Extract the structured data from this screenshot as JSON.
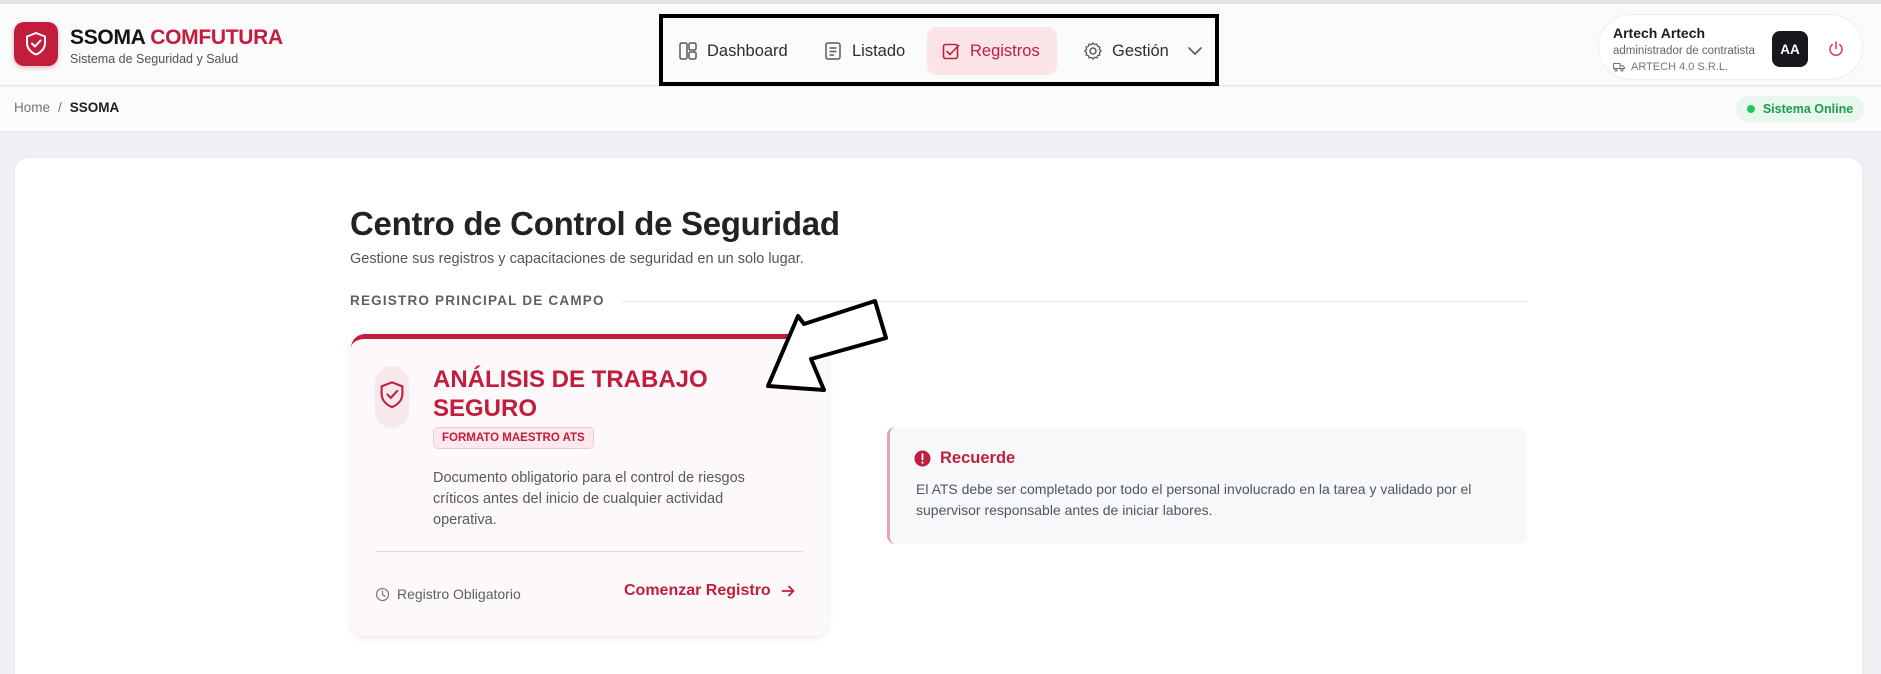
{
  "brand": {
    "title_main": "SSOMA",
    "title_accent": "COMFUTURA",
    "subtitle": "Sistema de Seguridad y Salud",
    "accent_color": "#c21d3c"
  },
  "nav": {
    "items": [
      {
        "label": "Dashboard",
        "icon": "layout-icon"
      },
      {
        "label": "Listado",
        "icon": "list-icon"
      },
      {
        "label": "Registros",
        "icon": "checkbox-icon",
        "active": true
      },
      {
        "label": "Gestión",
        "icon": "gear-icon"
      }
    ]
  },
  "user": {
    "name": "Artech Artech",
    "role": "administrador de contratista",
    "company": "ARTECH 4.0 S.R.L.",
    "initials": "AA"
  },
  "breadcrumb": {
    "home": "Home",
    "separator": "/",
    "current": "SSOMA"
  },
  "status": {
    "label": "Sistema Online",
    "color": "#22c55e"
  },
  "main": {
    "title": "Centro de Control de Seguridad",
    "subtitle": "Gestione sus registros y capacitaciones de seguridad en un solo lugar.",
    "section_label": "REGISTRO PRINCIPAL DE CAMPO"
  },
  "ats_card": {
    "title": "ANÁLISIS DE TRABAJO SEGURO",
    "badge": "FORMATO MAESTRO ATS",
    "description": "Documento obligatorio para el control de riesgos críticos antes del inicio de cualquier actividad operativa.",
    "footer_label": "Registro Obligatorio",
    "cta_label": "Comenzar Registro"
  },
  "reminder": {
    "title": "Recuerde",
    "text": "El ATS debe ser completado por todo el personal involucrado en la tarea y validado por el supervisor responsable antes de iniciar labores."
  }
}
